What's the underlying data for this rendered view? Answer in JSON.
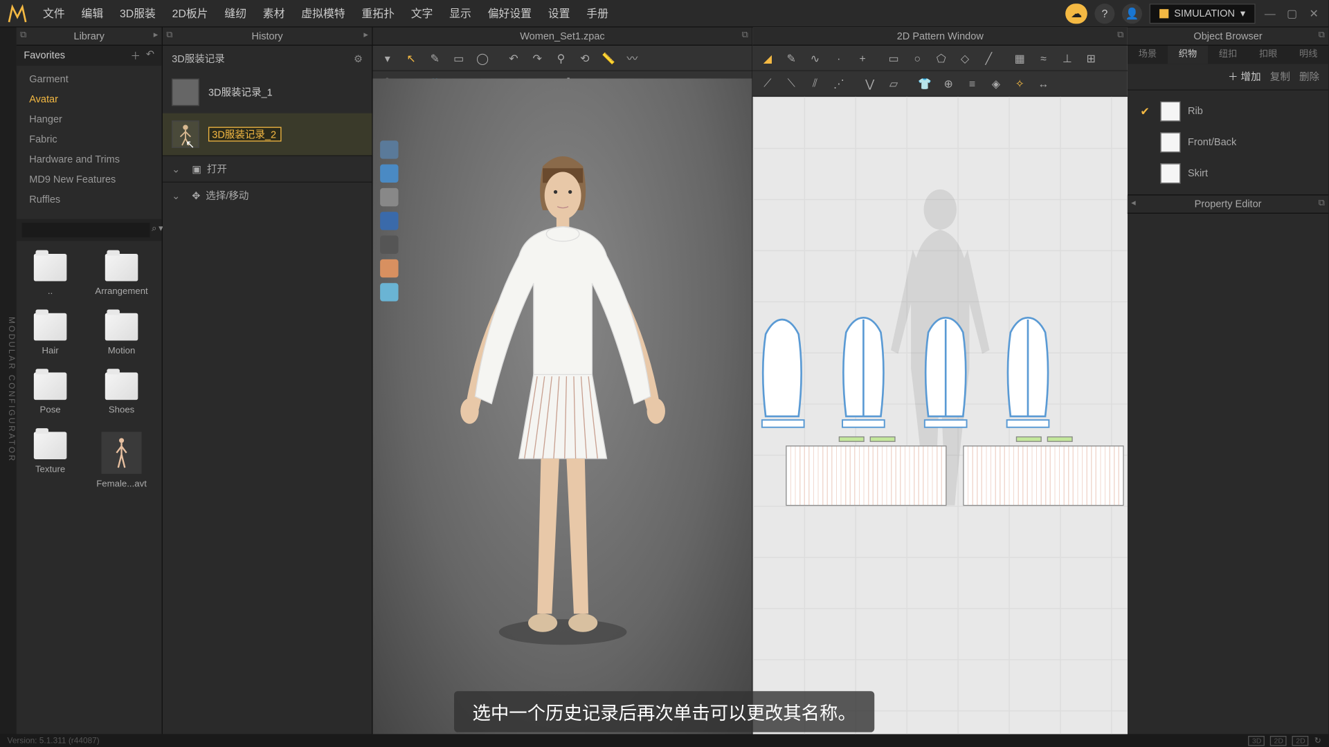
{
  "menubar": {
    "items": [
      "文件",
      "编辑",
      "3D服装",
      "2D板片",
      "缝纫",
      "素材",
      "虚拟模特",
      "重拓扑",
      "文字",
      "显示",
      "偏好设置",
      "设置",
      "手册"
    ],
    "simulation": "SIMULATION"
  },
  "left_rail": "MODULAR CONFIGURATOR",
  "library": {
    "title": "Library",
    "favorites_header": "Favorites",
    "categories": [
      "Garment",
      "Avatar",
      "Hanger",
      "Fabric",
      "Hardware and Trims",
      "MD9 New Features",
      "Ruffles"
    ],
    "active_category_index": 1,
    "thumbs": [
      "..",
      "Arrangement",
      "Hair",
      "Motion",
      "Pose",
      "Shoes",
      "Texture",
      "Female...avt"
    ]
  },
  "history": {
    "title": "History",
    "path": "3D服装记录",
    "items": [
      {
        "label": "3D服装记录_1",
        "selected": false
      },
      {
        "label": "3D服装记录_2",
        "selected": true,
        "editing": true
      }
    ],
    "sec_open": "打开",
    "sec_select": "选择/移动"
  },
  "view3d": {
    "title": "Women_Set1.zpac"
  },
  "view2d": {
    "title": "2D Pattern Window"
  },
  "object_browser": {
    "title": "Object Browser",
    "tabs": [
      "场景",
      "织物",
      "纽扣",
      "扣眼",
      "明线"
    ],
    "active_tab_index": 1,
    "add_btn": "增加",
    "copy_btn": "复制",
    "del_btn": "删除",
    "items": [
      {
        "label": "Rib",
        "checked": true
      },
      {
        "label": "Front/Back",
        "checked": false
      },
      {
        "label": "Skirt",
        "checked": false
      }
    ]
  },
  "property_editor": {
    "title": "Property Editor"
  },
  "subtitle": "选中一个历史记录后再次单击可以更改其名称。",
  "footer": {
    "version": "Version: 5.1.311 (r44087)",
    "boxes": [
      "3D",
      "2D",
      "2D"
    ]
  }
}
